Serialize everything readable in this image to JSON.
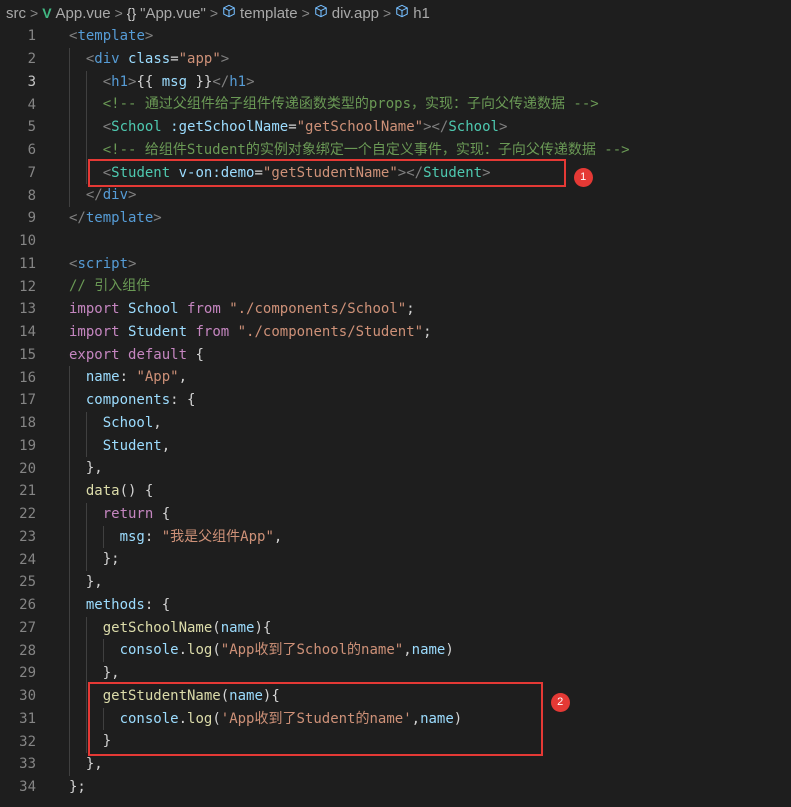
{
  "breadcrumb": {
    "items": [
      {
        "label": "src",
        "icon": ""
      },
      {
        "label": "App.vue",
        "icon": "vue-icon"
      },
      {
        "label": "\"App.vue\"",
        "icon": "braces-icon"
      },
      {
        "label": "template",
        "icon": "cube-icon"
      },
      {
        "label": "div.app",
        "icon": "cube-icon"
      },
      {
        "label": "h1",
        "icon": "cube-icon"
      }
    ],
    "separator": ">"
  },
  "editor": {
    "active_line": 3,
    "lines": [
      {
        "n": 1,
        "indent": 0,
        "tokens": [
          [
            "ang",
            "<"
          ],
          [
            "tag",
            "template"
          ],
          [
            "ang",
            ">"
          ]
        ]
      },
      {
        "n": 2,
        "indent": 1,
        "tokens": [
          [
            "ang",
            "<"
          ],
          [
            "tag",
            "div"
          ],
          [
            "punc",
            " "
          ],
          [
            "attr",
            "class"
          ],
          [
            "punc",
            "="
          ],
          [
            "str",
            "\"app\""
          ],
          [
            "ang",
            ">"
          ]
        ]
      },
      {
        "n": 3,
        "indent": 2,
        "tokens": [
          [
            "ang",
            "<"
          ],
          [
            "tag",
            "h1"
          ],
          [
            "ang",
            ">"
          ],
          [
            "punc",
            "{{ "
          ],
          [
            "var",
            "msg"
          ],
          [
            "punc",
            " }}"
          ],
          [
            "ang",
            "</"
          ],
          [
            "tag",
            "h1"
          ],
          [
            "ang",
            ">"
          ]
        ]
      },
      {
        "n": 4,
        "indent": 2,
        "tokens": [
          [
            "cmt",
            "<!-- 通过父组件给子组件传递函数类型的props，实现：子向父传递数据 -->"
          ]
        ]
      },
      {
        "n": 5,
        "indent": 2,
        "tokens": [
          [
            "ang",
            "<"
          ],
          [
            "cls",
            "School"
          ],
          [
            "punc",
            " "
          ],
          [
            "attr",
            ":getSchoolName"
          ],
          [
            "punc",
            "="
          ],
          [
            "str",
            "\"getSchoolName\""
          ],
          [
            "ang",
            "></"
          ],
          [
            "cls",
            "School"
          ],
          [
            "ang",
            ">"
          ]
        ]
      },
      {
        "n": 6,
        "indent": 2,
        "tokens": [
          [
            "cmt",
            "<!-- 给组件Student的实例对象绑定一个自定义事件，实现：子向父传递数据 -->"
          ]
        ]
      },
      {
        "n": 7,
        "indent": 2,
        "tokens": [
          [
            "ang",
            "<"
          ],
          [
            "cls",
            "Student"
          ],
          [
            "punc",
            " "
          ],
          [
            "attr",
            "v-on:demo"
          ],
          [
            "punc",
            "="
          ],
          [
            "str",
            "\"getStudentName\""
          ],
          [
            "ang",
            "></"
          ],
          [
            "cls",
            "Student"
          ],
          [
            "ang",
            ">"
          ]
        ]
      },
      {
        "n": 8,
        "indent": 1,
        "tokens": [
          [
            "ang",
            "</"
          ],
          [
            "tag",
            "div"
          ],
          [
            "ang",
            ">"
          ]
        ]
      },
      {
        "n": 9,
        "indent": 0,
        "tokens": [
          [
            "ang",
            "</"
          ],
          [
            "tag",
            "template"
          ],
          [
            "ang",
            ">"
          ]
        ]
      },
      {
        "n": 10,
        "indent": 0,
        "tokens": []
      },
      {
        "n": 11,
        "indent": 0,
        "tokens": [
          [
            "ang",
            "<"
          ],
          [
            "tag",
            "script"
          ],
          [
            "ang",
            ">"
          ]
        ]
      },
      {
        "n": 12,
        "indent": 0,
        "tokens": [
          [
            "cmt",
            "// 引入组件"
          ]
        ]
      },
      {
        "n": 13,
        "indent": 0,
        "tokens": [
          [
            "kw",
            "import"
          ],
          [
            "punc",
            " "
          ],
          [
            "var",
            "School"
          ],
          [
            "punc",
            " "
          ],
          [
            "kw",
            "from"
          ],
          [
            "punc",
            " "
          ],
          [
            "str",
            "\"./components/School\""
          ],
          [
            "punc",
            ";"
          ]
        ]
      },
      {
        "n": 14,
        "indent": 0,
        "tokens": [
          [
            "kw",
            "import"
          ],
          [
            "punc",
            " "
          ],
          [
            "var",
            "Student"
          ],
          [
            "punc",
            " "
          ],
          [
            "kw",
            "from"
          ],
          [
            "punc",
            " "
          ],
          [
            "str",
            "\"./components/Student\""
          ],
          [
            "punc",
            ";"
          ]
        ]
      },
      {
        "n": 15,
        "indent": 0,
        "tokens": [
          [
            "kw",
            "export"
          ],
          [
            "punc",
            " "
          ],
          [
            "kw",
            "default"
          ],
          [
            "punc",
            " {"
          ]
        ]
      },
      {
        "n": 16,
        "indent": 1,
        "tokens": [
          [
            "var",
            "name"
          ],
          [
            "punc",
            ": "
          ],
          [
            "str",
            "\"App\""
          ],
          [
            "punc",
            ","
          ]
        ]
      },
      {
        "n": 17,
        "indent": 1,
        "tokens": [
          [
            "var",
            "components"
          ],
          [
            "punc",
            ": {"
          ]
        ]
      },
      {
        "n": 18,
        "indent": 2,
        "tokens": [
          [
            "var",
            "School"
          ],
          [
            "punc",
            ","
          ]
        ]
      },
      {
        "n": 19,
        "indent": 2,
        "tokens": [
          [
            "var",
            "Student"
          ],
          [
            "punc",
            ","
          ]
        ]
      },
      {
        "n": 20,
        "indent": 1,
        "tokens": [
          [
            "punc",
            "},"
          ]
        ]
      },
      {
        "n": 21,
        "indent": 1,
        "tokens": [
          [
            "fn",
            "data"
          ],
          [
            "punc",
            "() {"
          ]
        ]
      },
      {
        "n": 22,
        "indent": 2,
        "tokens": [
          [
            "kw",
            "return"
          ],
          [
            "punc",
            " {"
          ]
        ]
      },
      {
        "n": 23,
        "indent": 3,
        "tokens": [
          [
            "var",
            "msg"
          ],
          [
            "punc",
            ": "
          ],
          [
            "str",
            "\"我是父组件App\""
          ],
          [
            "punc",
            ","
          ]
        ]
      },
      {
        "n": 24,
        "indent": 2,
        "tokens": [
          [
            "punc",
            "};"
          ]
        ]
      },
      {
        "n": 25,
        "indent": 1,
        "tokens": [
          [
            "punc",
            "},"
          ]
        ]
      },
      {
        "n": 26,
        "indent": 1,
        "tokens": [
          [
            "var",
            "methods"
          ],
          [
            "punc",
            ": {"
          ]
        ]
      },
      {
        "n": 27,
        "indent": 2,
        "tokens": [
          [
            "fn",
            "getSchoolName"
          ],
          [
            "punc",
            "("
          ],
          [
            "var",
            "name"
          ],
          [
            "punc",
            "){"
          ]
        ]
      },
      {
        "n": 28,
        "indent": 3,
        "tokens": [
          [
            "var",
            "console"
          ],
          [
            "punc",
            "."
          ],
          [
            "fn",
            "log"
          ],
          [
            "punc",
            "("
          ],
          [
            "str",
            "\"App收到了School的name\""
          ],
          [
            "punc",
            ","
          ],
          [
            "var",
            "name"
          ],
          [
            "punc",
            ")"
          ]
        ]
      },
      {
        "n": 29,
        "indent": 2,
        "tokens": [
          [
            "punc",
            "},"
          ]
        ]
      },
      {
        "n": 30,
        "indent": 2,
        "tokens": [
          [
            "fn",
            "getStudentName"
          ],
          [
            "punc",
            "("
          ],
          [
            "var",
            "name"
          ],
          [
            "punc",
            "){"
          ]
        ]
      },
      {
        "n": 31,
        "indent": 3,
        "tokens": [
          [
            "var",
            "console"
          ],
          [
            "punc",
            "."
          ],
          [
            "fn",
            "log"
          ],
          [
            "punc",
            "("
          ],
          [
            "str",
            "'App收到了Student的name'"
          ],
          [
            "punc",
            ","
          ],
          [
            "var",
            "name"
          ],
          [
            "punc",
            ")"
          ]
        ]
      },
      {
        "n": 32,
        "indent": 2,
        "tokens": [
          [
            "punc",
            "}"
          ]
        ]
      },
      {
        "n": 33,
        "indent": 1,
        "tokens": [
          [
            "punc",
            "},"
          ]
        ]
      },
      {
        "n": 34,
        "indent": 0,
        "tokens": [
          [
            "punc",
            "};"
          ]
        ]
      }
    ]
  },
  "annotations": [
    {
      "label": "1",
      "color": "#e53935",
      "lines": [
        7,
        7
      ]
    },
    {
      "label": "2",
      "color": "#e53935",
      "lines": [
        30,
        32
      ]
    }
  ]
}
